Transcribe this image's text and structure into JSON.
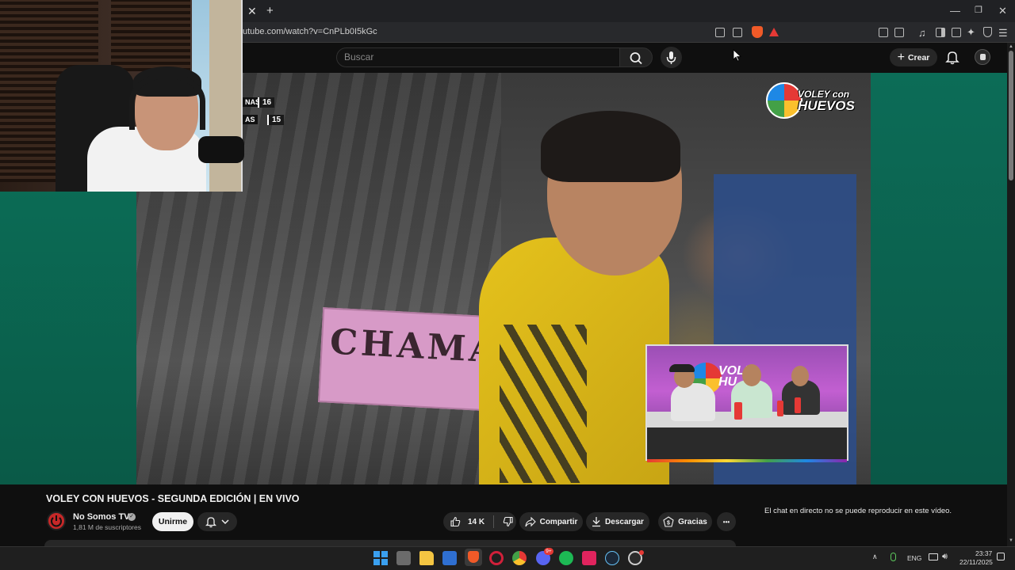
{
  "browser": {
    "tab_close": "✕",
    "new_tab": "+",
    "url": "utube.com/watch?v=CnPLb0I5kGc",
    "window_controls": {
      "minimize": "—",
      "maximize": "❐",
      "close": "✕"
    }
  },
  "youtube_header": {
    "search_placeholder": "Buscar",
    "create_label": "Crear"
  },
  "video": {
    "scoreboard": [
      {
        "team": "NAS",
        "score": "16"
      },
      {
        "team": "AS",
        "score": "15"
      }
    ],
    "logo_line1": "VOLEY con",
    "logo_line2": "HUEVOS",
    "banner_text": "CHAMA",
    "inset_logo_line1": "VOLE",
    "inset_logo_line2": "HU"
  },
  "details": {
    "title": "VOLEY CON HUEVOS - SEGUNDA EDICIÓN | EN VIVO",
    "channel_name": "No Somos TV",
    "subscribers": "1,81 M de suscriptores",
    "subscribe_label": "Unirme",
    "likes": "14 K",
    "share_label": "Compartir",
    "download_label": "Descargar",
    "thanks_label": "Gracias",
    "more_label": "•••"
  },
  "chat": {
    "message": "El chat en directo no se puede reproducir en este vídeo."
  },
  "taskbar": {
    "language": "ENG",
    "time": "23:37",
    "date": "22/11/2025",
    "badge_count": "9+"
  },
  "colors": {
    "youtube_bg": "#0f0f0f",
    "video_side": "#0a6a52",
    "jersey_yellow": "#e5c21c",
    "inset_purple": "#c25fd1"
  }
}
